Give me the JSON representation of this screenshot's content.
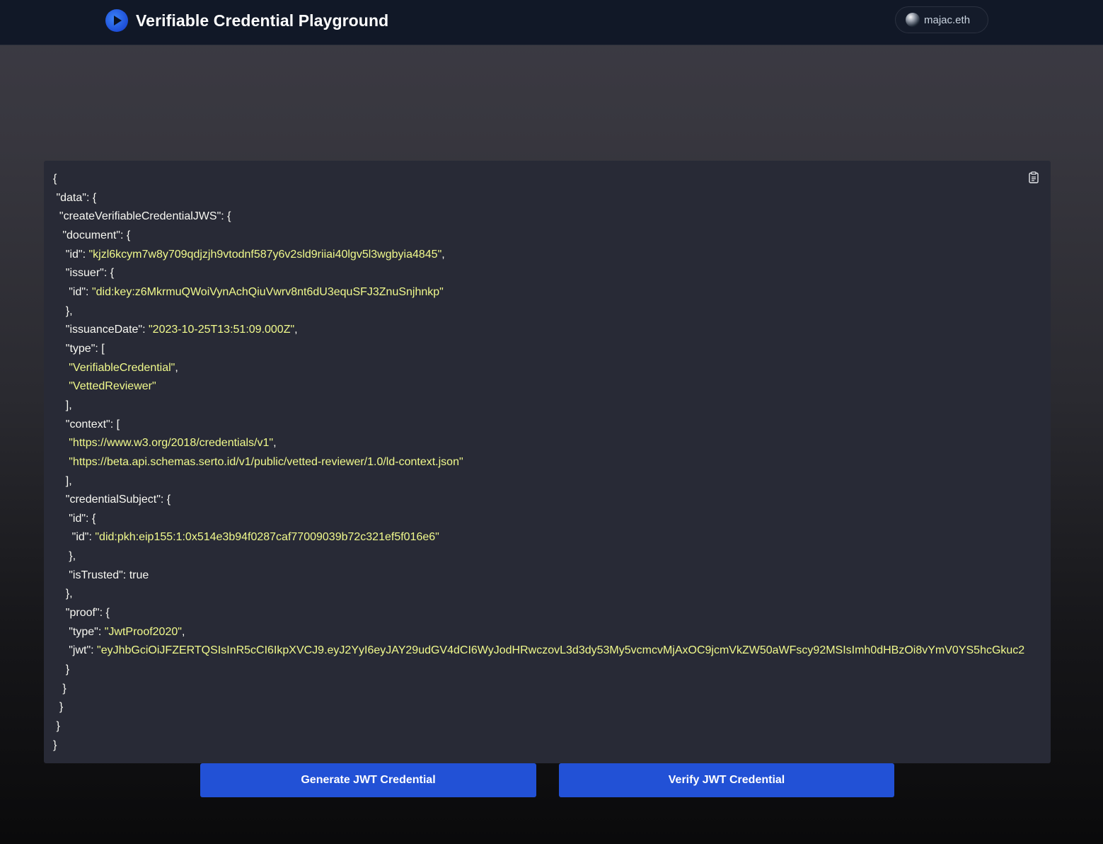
{
  "header": {
    "title": "Verifiable Credential Playground",
    "account_name": "majac.eth"
  },
  "code_view": {
    "lines": [
      {
        "indent": "",
        "key": "",
        "value": "",
        "tail": "{"
      },
      {
        "indent": " ",
        "key": "\"data\"",
        "value": "",
        "tail": ": {"
      },
      {
        "indent": "  ",
        "key": "\"createVerifiableCredentialJWS\"",
        "value": "",
        "tail": ": {"
      },
      {
        "indent": "   ",
        "key": "\"document\"",
        "value": "",
        "tail": ": {"
      },
      {
        "indent": "    ",
        "key": "\"id\"",
        "value": "\"kjzl6kcym7w8y709qdjzjh9vtodnf587y6v2sld9riiai40lgv5l3wgbyia4845\"",
        "tail": ","
      },
      {
        "indent": "    ",
        "key": "\"issuer\"",
        "value": "",
        "tail": ": {"
      },
      {
        "indent": "     ",
        "key": "\"id\"",
        "value": "\"did:key:z6MkrmuQWoiVynAchQiuVwrv8nt6dU3equSFJ3ZnuSnjhnkp\"",
        "tail": ""
      },
      {
        "indent": "    ",
        "key": "",
        "value": "",
        "tail": "},"
      },
      {
        "indent": "    ",
        "key": "\"issuanceDate\"",
        "value": "\"2023-10-25T13:51:09.000Z\"",
        "tail": ","
      },
      {
        "indent": "    ",
        "key": "\"type\"",
        "value": "",
        "tail": ": ["
      },
      {
        "indent": "     ",
        "key": "",
        "value": "\"VerifiableCredential\"",
        "tail": ","
      },
      {
        "indent": "     ",
        "key": "",
        "value": "\"VettedReviewer\"",
        "tail": ""
      },
      {
        "indent": "    ",
        "key": "",
        "value": "",
        "tail": "],"
      },
      {
        "indent": "    ",
        "key": "\"context\"",
        "value": "",
        "tail": ": ["
      },
      {
        "indent": "     ",
        "key": "",
        "value": "\"https://www.w3.org/2018/credentials/v1\"",
        "tail": ","
      },
      {
        "indent": "     ",
        "key": "",
        "value": "\"https://beta.api.schemas.serto.id/v1/public/vetted-reviewer/1.0/ld-context.json\"",
        "tail": ""
      },
      {
        "indent": "    ",
        "key": "",
        "value": "",
        "tail": "],"
      },
      {
        "indent": "    ",
        "key": "\"credentialSubject\"",
        "value": "",
        "tail": ": {"
      },
      {
        "indent": "     ",
        "key": "\"id\"",
        "value": "",
        "tail": ": {"
      },
      {
        "indent": "      ",
        "key": "\"id\"",
        "value": "\"did:pkh:eip155:1:0x514e3b94f0287caf77009039b72c321ef5f016e6\"",
        "tail": ""
      },
      {
        "indent": "     ",
        "key": "",
        "value": "",
        "tail": "},"
      },
      {
        "indent": "     ",
        "key": "\"isTrusted\"",
        "value": "",
        "tail": ": true"
      },
      {
        "indent": "    ",
        "key": "",
        "value": "",
        "tail": "},"
      },
      {
        "indent": "    ",
        "key": "\"proof\"",
        "value": "",
        "tail": ": {"
      },
      {
        "indent": "     ",
        "key": "\"type\"",
        "value": "\"JwtProof2020\"",
        "tail": ","
      },
      {
        "indent": "     ",
        "key": "\"jwt\"",
        "value": "\"eyJhbGciOiJFZERTQSIsInR5cCI6IkpXVCJ9.eyJ2YyI6eyJAY29udGV4dCI6WyJodHRwczovL3d3dy53My5vcmcvMjAxOC9jcmVkZW50aWFscy92MSIsImh0dHBzOi8vYmV0YS5hcGkuc2",
        "tail": ""
      },
      {
        "indent": "    ",
        "key": "",
        "value": "",
        "tail": "}"
      },
      {
        "indent": "   ",
        "key": "",
        "value": "",
        "tail": "}"
      },
      {
        "indent": "  ",
        "key": "",
        "value": "",
        "tail": "}"
      },
      {
        "indent": " ",
        "key": "",
        "value": "",
        "tail": "}"
      },
      {
        "indent": "",
        "key": "",
        "value": "",
        "tail": "}"
      }
    ]
  },
  "actions": {
    "generate_label": "Generate JWT Credential",
    "verify_label": "Verify JWT Credential"
  },
  "colors": {
    "accent": "#2251d6",
    "code_background": "#282a36",
    "string_color": "#f1fa8c",
    "header_background": "#111827"
  }
}
